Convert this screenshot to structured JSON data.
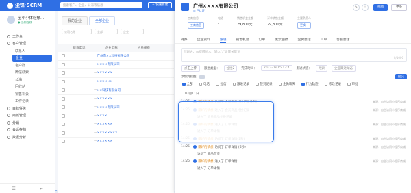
{
  "app": {
    "brand": "尘锋·SCRM",
    "search_placeholder": "搜索客户、企业、公海等信息",
    "new_button": "+ 快速新建"
  },
  "user": {
    "name": "宝小小体验账...",
    "status": "● 当前在线"
  },
  "sidebar": [
    {
      "label": "工作台",
      "level": "top"
    },
    {
      "label": "客户管理",
      "level": "top"
    },
    {
      "label": "联系人",
      "level": "sub"
    },
    {
      "label": "企业",
      "level": "sub",
      "active": true
    },
    {
      "label": "客户群",
      "level": "sub"
    },
    {
      "label": "微信线索",
      "level": "sub"
    },
    {
      "label": "公海",
      "level": "sub"
    },
    {
      "label": "回收站",
      "level": "sub"
    },
    {
      "label": "销售机会",
      "level": "sub"
    },
    {
      "label": "工作记录",
      "level": "sub"
    },
    {
      "label": "目标任务",
      "level": "top"
    },
    {
      "label": "商城管理",
      "level": "top"
    },
    {
      "label": "分销",
      "level": "top"
    },
    {
      "label": "会话存档",
      "level": "top"
    },
    {
      "label": "数据分析",
      "level": "top"
    }
  ],
  "list": {
    "tabs": [
      "我的企业",
      "全部企业"
    ],
    "filters": [
      "公司名称",
      "全部",
      "企业"
    ],
    "columns": [
      "联系电话",
      "企业全称",
      "人员规模"
    ],
    "rows": [
      "广州市××科技有限公司",
      "××××有限公司",
      "××××××",
      "××××××",
      "××科技有限公司",
      "××××××",
      "××××有限公司",
      "××××",
      "××××××",
      "××××××××",
      "××××××"
    ]
  },
  "drawer": {
    "company": "广州××××有限公司",
    "badge": "◎ 已认证",
    "actions": {
      "primary": "视图",
      "more": "更多"
    },
    "info": [
      {
        "label": "工商信息",
        "value": "工商信息"
      },
      {
        "label": "电话",
        "value": "-"
      },
      {
        "label": "销售机会金额",
        "value": "29,800元"
      },
      {
        "label": "订单销售金额",
        "value": "29,800元"
      },
      {
        "label": "主要负责人",
        "value": "更换"
      }
    ],
    "tabs": [
      "待办",
      "企业资料",
      "跟进",
      "销售机会",
      "订单",
      "发票回款",
      "企微会话",
      "工单",
      "客服会话"
    ],
    "note_placeholder": "写跟进，@提醒他人，输入“/”设置关键词",
    "note_count": "0/1000",
    "toolbar": {
      "quick_reply": "点击上传",
      "follow_type": "跟进类型：",
      "type_value": "拉拉2",
      "time_label": "完成时间：",
      "time_value": "2022-03-15 17:4",
      "status_label": "跟进状态：",
      "status_value": "线索",
      "visibility": "企业跟进动态"
    },
    "toggle_label": "添加到提醒",
    "save_label": "提交",
    "types": [
      {
        "label": "全部",
        "on": true
      },
      {
        "label": "电话",
        "on": false
      },
      {
        "label": "短信",
        "on": false
      },
      {
        "label": "跟进记录",
        "on": false
      },
      {
        "label": "签到记录",
        "on": false
      },
      {
        "label": "企微聊天",
        "on": false
      },
      {
        "label": "行为轨迹",
        "on": true
      },
      {
        "label": "修改记录",
        "on": false
      },
      {
        "label": "审批",
        "on": false
      }
    ],
    "date": "03月11日",
    "feed": [
      {
        "time": "14:25",
        "who": "暴好的梦想",
        "action": "访问了 会员商品兑换记录(1秒)",
        "source": "来源：自主访问小程序商城",
        "subline": ""
      },
      {
        "time": "14:25",
        "who": "暴好的梦想",
        "action": "进入了 会员商品兑换记录",
        "source": "来源：自主访问小程序商城",
        "subline": "进入了 会员商品兑换记录"
      },
      {
        "time": "14:25",
        "who": "暴好的梦想",
        "action": "进入了 订单详情",
        "source": "来源：自主访问小程序商城",
        "subline": "进入了 订单详情"
      },
      {
        "time": "14:25",
        "who": "暴好的梦想",
        "action": "访问了 订单详情(1秒)",
        "source": "来源：自主访问小程序商城",
        "subline": ""
      },
      {
        "time": "14:25",
        "who": "暴好的梦想",
        "action": "访问了 订单详情 (6秒)",
        "source": "来源：自主访问小程序商城",
        "subline": "访问了 商品首页"
      },
      {
        "time": "14:25",
        "who": "暴好的梦想",
        "action": "进入了 订单详情",
        "source": "来源：自主访问小程序商城",
        "subline": "进入了 订单详情"
      }
    ]
  }
}
